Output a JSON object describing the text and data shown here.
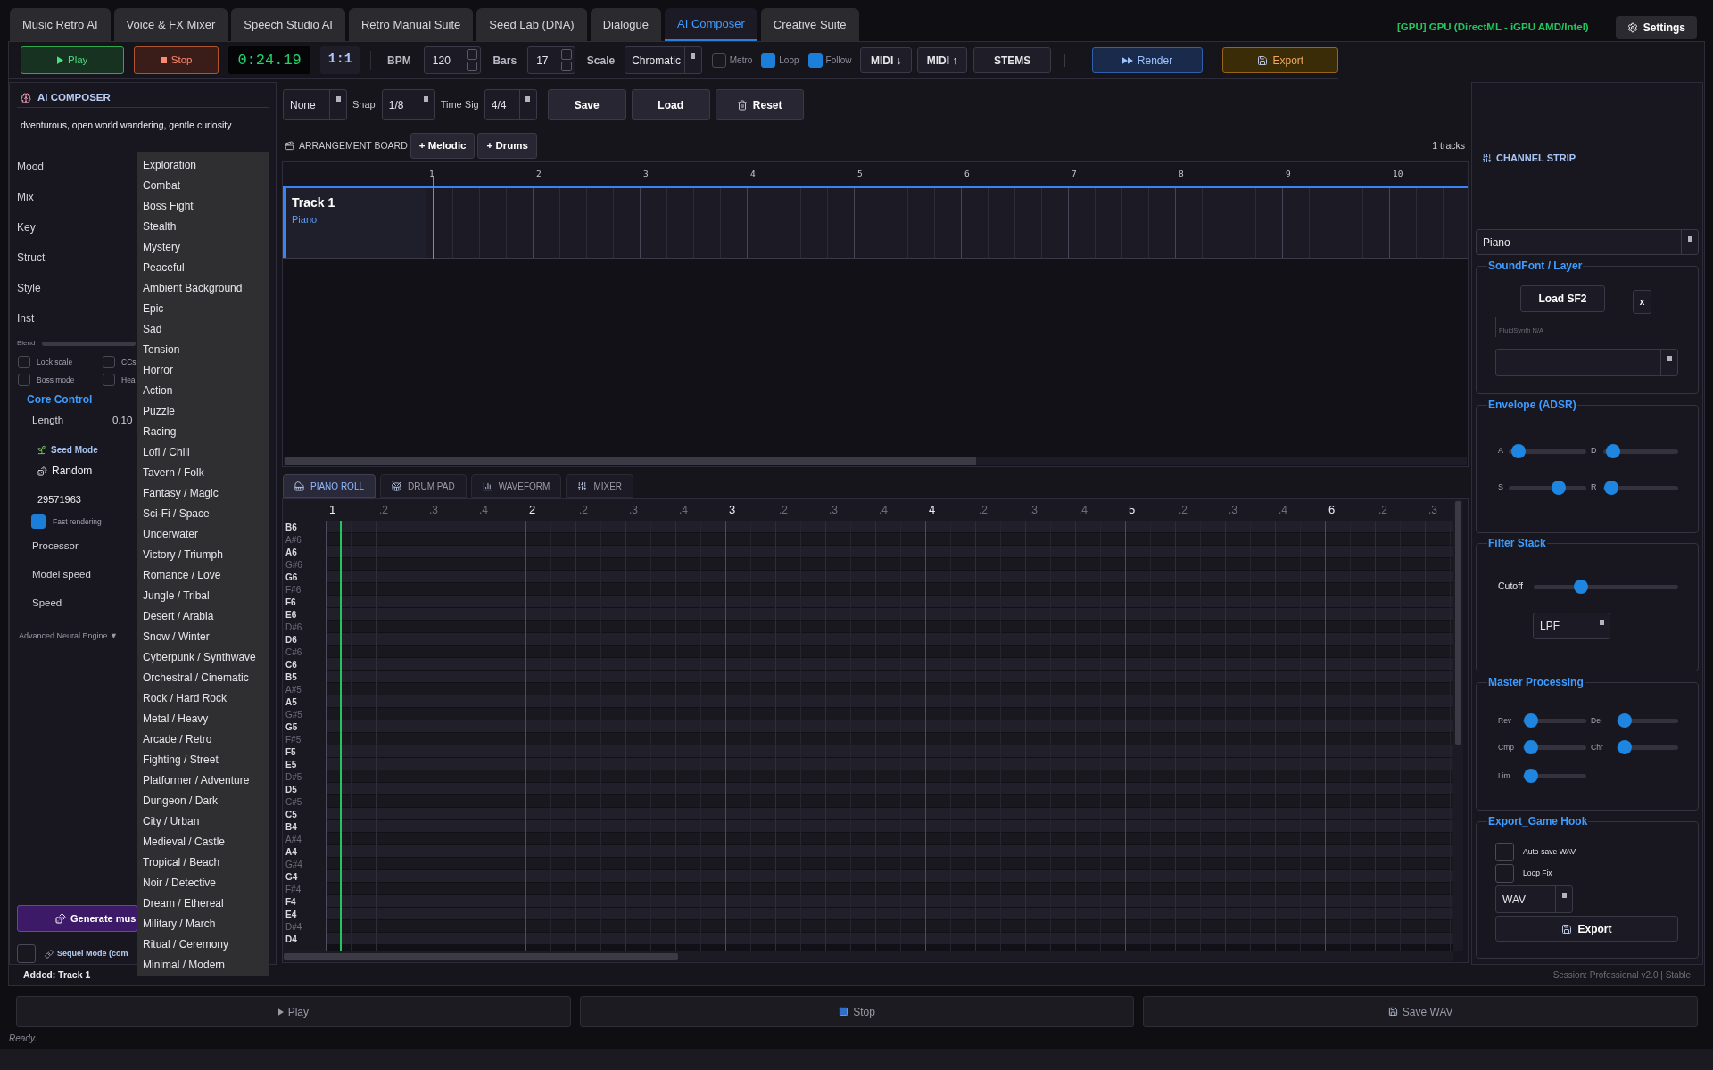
{
  "app_tabs": [
    {
      "label": "Music Retro AI",
      "selected": false
    },
    {
      "label": "Voice & FX Mixer",
      "selected": false
    },
    {
      "label": "Speech Studio AI",
      "selected": false
    },
    {
      "label": "Retro Manual Suite",
      "selected": false
    },
    {
      "label": "Seed Lab (DNA)",
      "selected": false
    },
    {
      "label": "Dialogue",
      "selected": false
    },
    {
      "label": "AI Composer",
      "selected": true
    },
    {
      "label": "Creative Suite",
      "selected": false
    }
  ],
  "gpu_status": "[GPU] GPU (DirectML - iGPU AMD/Intel)",
  "settings_button": "Settings",
  "transport": {
    "play": "Play",
    "stop": "Stop",
    "time": "0:24.19",
    "position": "1:1",
    "bpm": {
      "label": "BPM",
      "value": "120"
    },
    "bars": {
      "label": "Bars",
      "value": "17"
    },
    "scale": {
      "label": "Scale",
      "value": "Chromatic"
    },
    "toggles": [
      {
        "label": "Metro",
        "checked": false
      },
      {
        "label": "Loop",
        "checked": true
      },
      {
        "label": "Follow",
        "checked": true
      }
    ],
    "midi_buttons": [
      "MIDI ↓",
      "MIDI ↑"
    ],
    "stems": "STEMS",
    "render": "Render",
    "export": "Export"
  },
  "composer": {
    "title": "AI COMPOSER",
    "prompt": "dventurous, open world wandering, gentle curiosity",
    "fields": [
      "Mood",
      "Mix",
      "Key",
      "Struct",
      "Style",
      "Inst"
    ],
    "blend_label": "Blend",
    "options": [
      {
        "label": "Lock scale",
        "checked": false
      },
      {
        "label": "CCs",
        "checked": false
      },
      {
        "label": "Boss mode",
        "checked": false
      },
      {
        "label": "Hea",
        "checked": false
      }
    ],
    "core_title": "Core Control",
    "length": {
      "label": "Length",
      "value": "0.10"
    },
    "seed_mode_label": "Seed Mode",
    "seed_mode": "Random",
    "seed": "29571963",
    "fast_rendering": {
      "label": "Fast rendering",
      "checked": true
    },
    "settings": [
      "Processor",
      "Model speed",
      "Speed"
    ],
    "advanced": "Advanced Neural Engine ▼",
    "generate": "Generate mus",
    "sequel": {
      "label": "Sequel Mode (com",
      "checked": false
    }
  },
  "mood_menu": [
    "Exploration",
    "Combat",
    "Boss Fight",
    "Stealth",
    "Mystery",
    "Peaceful",
    "Ambient Background",
    "Epic",
    "Sad",
    "Tension",
    "Horror",
    "Action",
    "Puzzle",
    "Racing",
    "Lofi / Chill",
    "Tavern / Folk",
    "Fantasy / Magic",
    "Sci-Fi / Space",
    "Underwater",
    "Victory / Triumph",
    "Romance / Love",
    "Jungle / Tribal",
    "Desert / Arabia",
    "Snow / Winter",
    "Cyberpunk / Synthwave",
    "Orchestral / Cinematic",
    "Rock / Hard Rock",
    "Metal / Heavy",
    "Arcade / Retro",
    "Fighting / Street",
    "Platformer / Adventure",
    "Dungeon / Dark",
    "City / Urban",
    "Medieval / Castle",
    "Tropical / Beach",
    "Noir / Detective",
    "Dream / Ethereal",
    "Military / March",
    "Ritual / Ceremony",
    "Minimal / Modern"
  ],
  "editor_toolbar": {
    "quantize": "None",
    "snap": {
      "label": "Snap",
      "value": "1/8"
    },
    "time_signature": {
      "label": "Time Sig",
      "value": "4/4"
    },
    "save": "Save",
    "load": "Load",
    "reset": "Reset"
  },
  "arrangement": {
    "title": "ARRANGEMENT BOARD",
    "add_buttons": [
      "+ Melodic",
      "+ Drums"
    ],
    "track_count": "1 tracks",
    "ruler": [
      "1",
      "2",
      "3",
      "4",
      "5",
      "6",
      "7",
      "8",
      "9",
      "10"
    ],
    "tracks": [
      {
        "name": "Track 1",
        "instrument": "Piano",
        "selected": true
      }
    ]
  },
  "view_tabs": [
    {
      "label": "PIANO ROLL",
      "selected": true
    },
    {
      "label": "DRUM PAD",
      "selected": false
    },
    {
      "label": "WAVEFORM",
      "selected": false
    },
    {
      "label": "MIXER",
      "selected": false
    }
  ],
  "piano_roll": {
    "ruler": [
      {
        "label": "1",
        "kind": "bar"
      },
      {
        "label": ".2",
        "kind": "beat"
      },
      {
        "label": ".3",
        "kind": "beat"
      },
      {
        "label": ".4",
        "kind": "beat"
      },
      {
        "label": "2",
        "kind": "bar"
      },
      {
        "label": ".2",
        "kind": "beat"
      },
      {
        "label": ".3",
        "kind": "beat"
      },
      {
        "label": ".4",
        "kind": "beat"
      },
      {
        "label": "3",
        "kind": "bar"
      },
      {
        "label": ".2",
        "kind": "beat"
      },
      {
        "label": ".3",
        "kind": "beat"
      },
      {
        "label": ".4",
        "kind": "beat"
      },
      {
        "label": "4",
        "kind": "bar"
      },
      {
        "label": ".2",
        "kind": "beat"
      },
      {
        "label": ".3",
        "kind": "beat"
      },
      {
        "label": ".4",
        "kind": "beat"
      },
      {
        "label": "5",
        "kind": "bar"
      },
      {
        "label": ".2",
        "kind": "beat"
      },
      {
        "label": ".3",
        "kind": "beat"
      },
      {
        "label": ".4",
        "kind": "beat"
      },
      {
        "label": "6",
        "kind": "bar"
      },
      {
        "label": ".2",
        "kind": "beat"
      },
      {
        "label": ".3",
        "kind": "beat"
      }
    ],
    "notes": [
      {
        "label": "B6",
        "kind": "natural"
      },
      {
        "label": "A#6",
        "kind": "sharp"
      },
      {
        "label": "A6",
        "kind": "natural"
      },
      {
        "label": "G#6",
        "kind": "sharp"
      },
      {
        "label": "G6",
        "kind": "natural"
      },
      {
        "label": "F#6",
        "kind": "sharp"
      },
      {
        "label": "F6",
        "kind": "natural"
      },
      {
        "label": "E6",
        "kind": "natural"
      },
      {
        "label": "D#6",
        "kind": "sharp"
      },
      {
        "label": "D6",
        "kind": "natural"
      },
      {
        "label": "C#6",
        "kind": "sharp"
      },
      {
        "label": "C6",
        "kind": "natural"
      },
      {
        "label": "B5",
        "kind": "natural"
      },
      {
        "label": "A#5",
        "kind": "sharp"
      },
      {
        "label": "A5",
        "kind": "natural"
      },
      {
        "label": "G#5",
        "kind": "sharp"
      },
      {
        "label": "G5",
        "kind": "natural"
      },
      {
        "label": "F#5",
        "kind": "sharp"
      },
      {
        "label": "F5",
        "kind": "natural"
      },
      {
        "label": "E5",
        "kind": "natural"
      },
      {
        "label": "D#5",
        "kind": "sharp"
      },
      {
        "label": "D5",
        "kind": "natural"
      },
      {
        "label": "C#5",
        "kind": "sharp"
      },
      {
        "label": "C5",
        "kind": "natural"
      },
      {
        "label": "B4",
        "kind": "natural"
      },
      {
        "label": "A#4",
        "kind": "sharp"
      },
      {
        "label": "A4",
        "kind": "natural"
      },
      {
        "label": "G#4",
        "kind": "sharp"
      },
      {
        "label": "G4",
        "kind": "natural"
      },
      {
        "label": "F#4",
        "kind": "sharp"
      },
      {
        "label": "F4",
        "kind": "natural"
      },
      {
        "label": "E4",
        "kind": "natural"
      },
      {
        "label": "D#4",
        "kind": "sharp"
      },
      {
        "label": "D4",
        "kind": "natural"
      }
    ]
  },
  "channel_strip": {
    "title": "CHANNEL STRIP",
    "instrument": "Piano",
    "soundfont": {
      "title": "SoundFont / Layer",
      "load_button": "Load SF2",
      "clear_button": "x",
      "engine_status": "FluidSynth N/A"
    },
    "envelope": {
      "title": "Envelope (ADSR)",
      "sliders": [
        {
          "label": "A",
          "level": 0.04
        },
        {
          "label": "D",
          "level": 0.05
        },
        {
          "label": "S",
          "level": 0.68
        },
        {
          "label": "R",
          "level": 0.02
        }
      ]
    },
    "filter": {
      "title": "Filter Stack",
      "cutoff": {
        "label": "Cutoff",
        "level": 0.31
      },
      "mode": "LPF"
    },
    "master": {
      "title": "Master Processing",
      "sliders": [
        {
          "label": "Rev",
          "level": 0.02
        },
        {
          "label": "Del",
          "level": 0.02
        },
        {
          "label": "Cmp",
          "level": 0.02
        },
        {
          "label": "Chr",
          "level": 0.02
        },
        {
          "label": "Lim",
          "level": 0.02
        }
      ]
    },
    "export": {
      "title": "Export_Game Hook",
      "options": [
        {
          "label": "Auto-save WAV",
          "checked": false
        },
        {
          "label": "Loop Fix",
          "checked": false
        }
      ],
      "format": "WAV",
      "button": "Export"
    }
  },
  "status_bar": {
    "message": "Added: Track 1",
    "session": "Session: Professional v2.0 | Stable"
  },
  "footer": {
    "buttons": [
      "Play",
      "Stop",
      "Save WAV"
    ],
    "status": "Ready."
  }
}
